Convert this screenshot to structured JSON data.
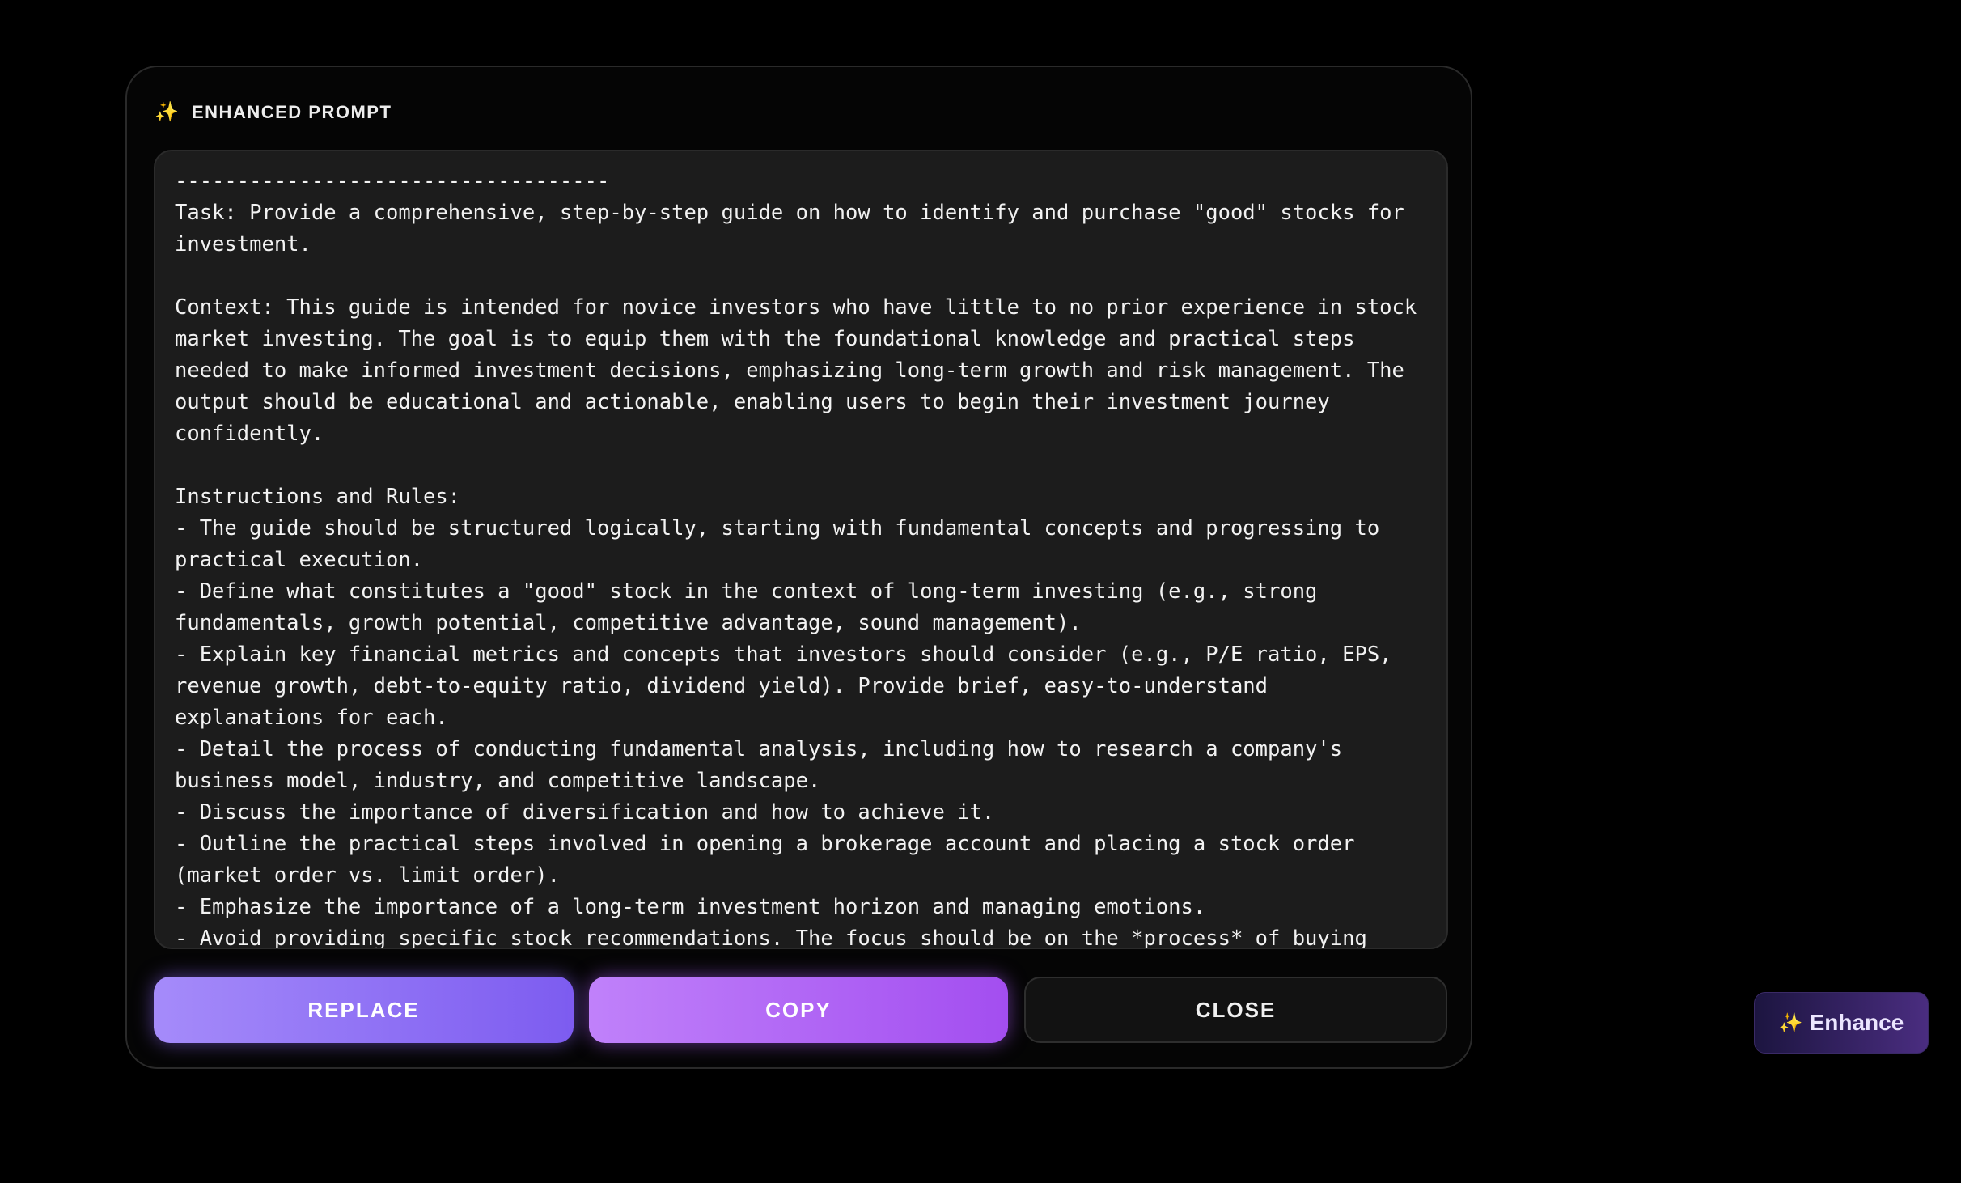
{
  "dialog": {
    "title": "ENHANCED PROMPT",
    "title_icon": "sparkles-icon",
    "prompt_text": "-----------------------------------\nTask: Provide a comprehensive, step-by-step guide on how to identify and purchase \"good\" stocks for investment.\n\nContext: This guide is intended for novice investors who have little to no prior experience in stock market investing. The goal is to equip them with the foundational knowledge and practical steps needed to make informed investment decisions, emphasizing long-term growth and risk management. The output should be educational and actionable, enabling users to begin their investment journey confidently.\n\nInstructions and Rules:\n- The guide should be structured logically, starting with fundamental concepts and progressing to practical execution.\n- Define what constitutes a \"good\" stock in the context of long-term investing (e.g., strong fundamentals, growth potential, competitive advantage, sound management).\n- Explain key financial metrics and concepts that investors should consider (e.g., P/E ratio, EPS, revenue growth, debt-to-equity ratio, dividend yield). Provide brief, easy-to-understand explanations for each.\n- Detail the process of conducting fundamental analysis, including how to research a company's business model, industry, and competitive landscape.\n- Discuss the importance of diversification and how to achieve it.\n- Outline the practical steps involved in opening a brokerage account and placing a stock order (market order vs. limit order).\n- Emphasize the importance of a long-term investment horizon and managing emotions.\n- Avoid providing specific stock recommendations. The focus should be on the *process* of buying good stocks, not on *which* stocks to buy.\n- Maintain an encouraging, educational, and accessible tone. Avoid overly technical jargon where possible, or explain it clearly if necessary.\n- The output should be well-organized with clear headings and subheadings for readability.",
    "buttons": {
      "replace": "REPLACE",
      "copy": "COPY",
      "close": "CLOSE"
    }
  },
  "enhance_button": {
    "label": "Enhance",
    "icon": "sparkles-icon"
  },
  "colors": {
    "background": "#000000",
    "dialog_border": "#2a2a2a",
    "textbox_bg": "#1c1c1c",
    "replace_gradient": [
      "#a58bfa",
      "#7d5cf0"
    ],
    "copy_gradient": [
      "#c081fa",
      "#a34ef0"
    ],
    "close_bg": "#121212",
    "enhance_gradient": [
      "#1c1540",
      "#4a2d80"
    ]
  }
}
